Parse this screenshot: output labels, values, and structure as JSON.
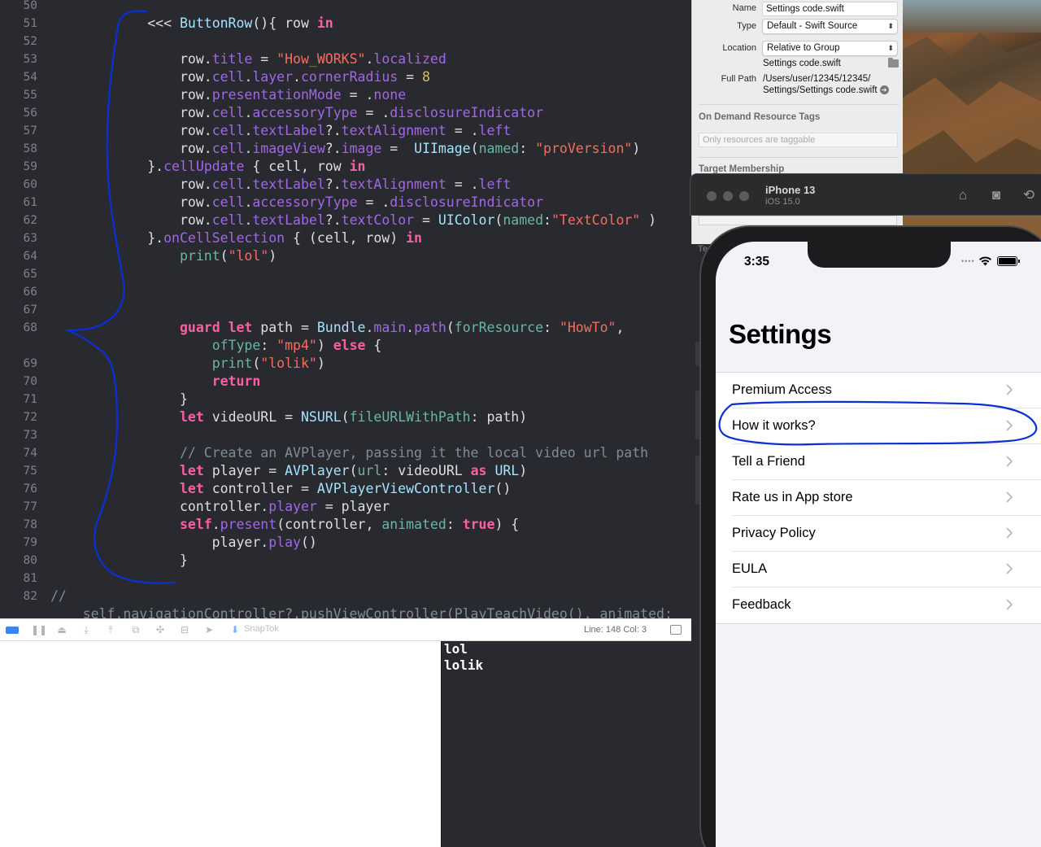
{
  "editor": {
    "lines": [
      {
        "n": "50",
        "tokens": []
      },
      {
        "n": "51",
        "tokens": [
          [
            "plain",
            "            <<< "
          ],
          [
            "type",
            "ButtonRow"
          ],
          [
            "plain",
            "(){ row "
          ],
          [
            "kw",
            "in"
          ]
        ]
      },
      {
        "n": "52",
        "tokens": []
      },
      {
        "n": "53",
        "tokens": [
          [
            "plain",
            "                row."
          ],
          [
            "prop",
            "title"
          ],
          [
            "plain",
            " = "
          ],
          [
            "str",
            "\"How_WORKS\""
          ],
          [
            "plain",
            "."
          ],
          [
            "prop",
            "localized"
          ]
        ]
      },
      {
        "n": "54",
        "tokens": [
          [
            "plain",
            "                row."
          ],
          [
            "prop",
            "cell"
          ],
          [
            "plain",
            "."
          ],
          [
            "prop",
            "layer"
          ],
          [
            "plain",
            "."
          ],
          [
            "prop",
            "cornerRadius"
          ],
          [
            "plain",
            " = "
          ],
          [
            "num",
            "8"
          ]
        ]
      },
      {
        "n": "55",
        "tokens": [
          [
            "plain",
            "                row."
          ],
          [
            "prop",
            "presentationMode"
          ],
          [
            "plain",
            " = ."
          ],
          [
            "prop",
            "none"
          ]
        ]
      },
      {
        "n": "56",
        "tokens": [
          [
            "plain",
            "                row."
          ],
          [
            "prop",
            "cell"
          ],
          [
            "plain",
            "."
          ],
          [
            "prop",
            "accessoryType"
          ],
          [
            "plain",
            " = ."
          ],
          [
            "prop",
            "disclosureIndicator"
          ]
        ]
      },
      {
        "n": "57",
        "tokens": [
          [
            "plain",
            "                row."
          ],
          [
            "prop",
            "cell"
          ],
          [
            "plain",
            "."
          ],
          [
            "prop",
            "textLabel"
          ],
          [
            "plain",
            "?."
          ],
          [
            "prop",
            "textAlignment"
          ],
          [
            "plain",
            " = ."
          ],
          [
            "prop",
            "left"
          ]
        ]
      },
      {
        "n": "58",
        "tokens": [
          [
            "plain",
            "                row."
          ],
          [
            "prop",
            "cell"
          ],
          [
            "plain",
            "."
          ],
          [
            "prop",
            "imageView"
          ],
          [
            "plain",
            "?."
          ],
          [
            "prop",
            "image"
          ],
          [
            "plain",
            " =  "
          ],
          [
            "type",
            "UIImage"
          ],
          [
            "plain",
            "("
          ],
          [
            "fn",
            "named"
          ],
          [
            "plain",
            ": "
          ],
          [
            "str",
            "\"proVersion\""
          ],
          [
            "plain",
            ")"
          ]
        ]
      },
      {
        "n": "59",
        "tokens": [
          [
            "plain",
            "            }."
          ],
          [
            "prop",
            "cellUpdate"
          ],
          [
            "plain",
            " { cell, row "
          ],
          [
            "kw",
            "in"
          ]
        ]
      },
      {
        "n": "60",
        "tokens": [
          [
            "plain",
            "                row."
          ],
          [
            "prop",
            "cell"
          ],
          [
            "plain",
            "."
          ],
          [
            "prop",
            "textLabel"
          ],
          [
            "plain",
            "?."
          ],
          [
            "prop",
            "textAlignment"
          ],
          [
            "plain",
            " = ."
          ],
          [
            "prop",
            "left"
          ]
        ]
      },
      {
        "n": "61",
        "tokens": [
          [
            "plain",
            "                row."
          ],
          [
            "prop",
            "cell"
          ],
          [
            "plain",
            "."
          ],
          [
            "prop",
            "accessoryType"
          ],
          [
            "plain",
            " = ."
          ],
          [
            "prop",
            "disclosureIndicator"
          ]
        ]
      },
      {
        "n": "62",
        "tokens": [
          [
            "plain",
            "                row."
          ],
          [
            "prop",
            "cell"
          ],
          [
            "plain",
            "."
          ],
          [
            "prop",
            "textLabel"
          ],
          [
            "plain",
            "?."
          ],
          [
            "prop",
            "textColor"
          ],
          [
            "plain",
            " = "
          ],
          [
            "type",
            "UIColor"
          ],
          [
            "plain",
            "("
          ],
          [
            "fn",
            "named"
          ],
          [
            "plain",
            ":"
          ],
          [
            "str",
            "\"TextColor\""
          ],
          [
            "plain",
            " )"
          ]
        ]
      },
      {
        "n": "63",
        "tokens": [
          [
            "plain",
            "            }."
          ],
          [
            "prop",
            "onCellSelection"
          ],
          [
            "plain",
            " { (cell, row) "
          ],
          [
            "kw",
            "in"
          ]
        ]
      },
      {
        "n": "64",
        "tokens": [
          [
            "plain",
            "                "
          ],
          [
            "fn",
            "print"
          ],
          [
            "plain",
            "("
          ],
          [
            "str",
            "\"lol\""
          ],
          [
            "plain",
            ")"
          ]
        ]
      },
      {
        "n": "65",
        "tokens": []
      },
      {
        "n": "66",
        "tokens": []
      },
      {
        "n": "67",
        "tokens": []
      },
      {
        "n": "68",
        "tokens": [
          [
            "plain",
            "                "
          ],
          [
            "kw",
            "guard"
          ],
          [
            "plain",
            " "
          ],
          [
            "kw",
            "let"
          ],
          [
            "plain",
            " path = "
          ],
          [
            "type",
            "Bundle"
          ],
          [
            "plain",
            "."
          ],
          [
            "prop",
            "main"
          ],
          [
            "plain",
            "."
          ],
          [
            "prop",
            "path"
          ],
          [
            "plain",
            "("
          ],
          [
            "fn",
            "forResource"
          ],
          [
            "plain",
            ": "
          ],
          [
            "str",
            "\"HowTo\""
          ],
          [
            "plain",
            ","
          ]
        ]
      },
      {
        "n": "",
        "tokens": [
          [
            "plain",
            "                    "
          ],
          [
            "fn",
            "ofType"
          ],
          [
            "plain",
            ": "
          ],
          [
            "str",
            "\"mp4\""
          ],
          [
            "plain",
            ") "
          ],
          [
            "kw",
            "else"
          ],
          [
            "plain",
            " {"
          ]
        ]
      },
      {
        "n": "69",
        "tokens": [
          [
            "plain",
            "                    "
          ],
          [
            "fn",
            "print"
          ],
          [
            "plain",
            "("
          ],
          [
            "str",
            "\"lolik\""
          ],
          [
            "plain",
            ")"
          ]
        ]
      },
      {
        "n": "70",
        "tokens": [
          [
            "plain",
            "                    "
          ],
          [
            "kw",
            "return"
          ]
        ]
      },
      {
        "n": "71",
        "tokens": [
          [
            "plain",
            "                }"
          ]
        ]
      },
      {
        "n": "72",
        "tokens": [
          [
            "plain",
            "                "
          ],
          [
            "kw",
            "let"
          ],
          [
            "plain",
            " videoURL = "
          ],
          [
            "type",
            "NSURL"
          ],
          [
            "plain",
            "("
          ],
          [
            "fn",
            "fileURLWithPath"
          ],
          [
            "plain",
            ": path)"
          ]
        ]
      },
      {
        "n": "73",
        "tokens": []
      },
      {
        "n": "74",
        "tokens": [
          [
            "com",
            "                // Create an AVPlayer, passing it the local video url path"
          ]
        ]
      },
      {
        "n": "75",
        "tokens": [
          [
            "plain",
            "                "
          ],
          [
            "kw",
            "let"
          ],
          [
            "plain",
            " player = "
          ],
          [
            "type",
            "AVPlayer"
          ],
          [
            "plain",
            "("
          ],
          [
            "fn",
            "url"
          ],
          [
            "plain",
            ": videoURL "
          ],
          [
            "kw",
            "as"
          ],
          [
            "plain",
            " "
          ],
          [
            "type",
            "URL"
          ],
          [
            "plain",
            ")"
          ]
        ]
      },
      {
        "n": "76",
        "tokens": [
          [
            "plain",
            "                "
          ],
          [
            "kw",
            "let"
          ],
          [
            "plain",
            " controller = "
          ],
          [
            "type",
            "AVPlayerViewController"
          ],
          [
            "plain",
            "()"
          ]
        ]
      },
      {
        "n": "77",
        "tokens": [
          [
            "plain",
            "                controller."
          ],
          [
            "prop",
            "player"
          ],
          [
            "plain",
            " = player"
          ]
        ]
      },
      {
        "n": "78",
        "tokens": [
          [
            "plain",
            "                "
          ],
          [
            "self",
            "self"
          ],
          [
            "plain",
            "."
          ],
          [
            "prop",
            "present"
          ],
          [
            "plain",
            "(controller, "
          ],
          [
            "fn",
            "animated"
          ],
          [
            "plain",
            ": "
          ],
          [
            "kw",
            "true"
          ],
          [
            "plain",
            ") {"
          ]
        ]
      },
      {
        "n": "79",
        "tokens": [
          [
            "plain",
            "                    player."
          ],
          [
            "prop",
            "play"
          ],
          [
            "plain",
            "()"
          ]
        ]
      },
      {
        "n": "80",
        "tokens": [
          [
            "plain",
            "                }"
          ]
        ]
      },
      {
        "n": "81",
        "tokens": []
      },
      {
        "n": "82",
        "tokens": [
          [
            "com",
            "//"
          ]
        ]
      },
      {
        "n": "",
        "tokens": [
          [
            "com",
            "    self.navigationController?.pushViewController(PlayTeachVideo(), animated:"
          ]
        ]
      }
    ]
  },
  "debug_bar": {
    "snaptok": "SnapTok",
    "line_col": "Line: 148  Col: 3"
  },
  "console": {
    "lines": [
      "lol",
      "lolik"
    ]
  },
  "inspector": {
    "name_label": "Name",
    "name_value": "Settings code.swift",
    "type_label": "Type",
    "type_value": "Default - Swift Source",
    "location_label": "Location",
    "location_value": "Relative to Group",
    "location_file": "Settings code.swift",
    "fullpath_label": "Full Path",
    "fullpath_line1": "/Users/user/12345/12345/",
    "fullpath_line2": "Settings/Settings code.swift",
    "odr_header": "On Demand Resource Tags",
    "odr_placeholder": "Only resources are taggable",
    "target_header": "Target Membership"
  },
  "simulator": {
    "device_name": "iPhone 13",
    "os_version": "iOS 15.0",
    "partial_label": "Te"
  },
  "phone": {
    "time": "3:35",
    "title": "Settings",
    "rows": [
      "Premium Access",
      "How it works?",
      "Tell a Friend",
      "Rate us in App store",
      "Privacy Policy",
      "EULA",
      "Feedback"
    ]
  },
  "colors": {
    "editor_bg": "#292a30",
    "keyword": "#fc5fa3",
    "string": "#fc6a5d",
    "number": "#d0bf69",
    "property": "#a167e6",
    "type": "#a2e4ff",
    "annotation_pen": "#0b2fd4"
  }
}
